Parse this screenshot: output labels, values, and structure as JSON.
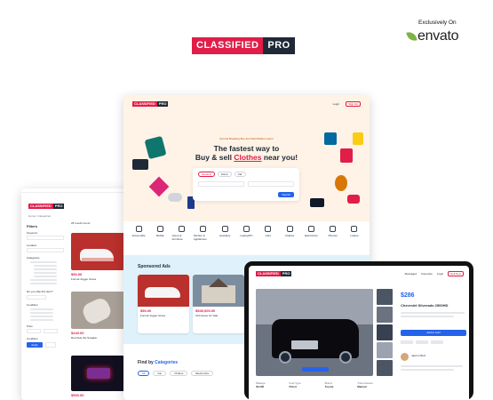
{
  "brand": {
    "name_part1": "CLASSIFIED",
    "name_part2": "PRO",
    "exclusive": "Exclusively On",
    "marketplace": "envato"
  },
  "colors": {
    "accent": "#e11d48",
    "dark": "#1f2937",
    "hero_bg": "#fef3e6",
    "sponsored_bg": "#dff1fb",
    "primary_blue": "#2563eb",
    "envato_green": "#7cb342"
  },
  "center": {
    "tagline": "Ground Breaking Buy And Sell Platform Here!",
    "hero_line1": "The fastest way to",
    "hero_line2_pre": "Buy & sell ",
    "hero_line2_highlight": "Clothes",
    "hero_line2_post": " near you!",
    "search_tabs": [
      "General",
      "Home",
      "Car"
    ],
    "search_button": "Search",
    "nav": [
      "Login",
      "Sign Up"
    ],
    "categories": [
      "Automobile",
      "Mobile",
      "Home & Furniture",
      "Kitchen & Appliances",
      "Jewellery",
      "Laptop/PC",
      "Cars",
      "Clothes",
      "Electronics",
      "Phones",
      "Laptop"
    ],
    "sponsored_title": "Sponsored Ads",
    "ads": [
      {
        "price": "$50.00",
        "title": "Formal Jogger shoes"
      },
      {
        "price": "$545,000.00",
        "title": "Old House for Sale"
      }
    ],
    "find_by_pre": "Find by ",
    "find_by_highlight": "Categories",
    "find_tabs": [
      "All",
      "Car",
      "Clothes",
      "Electronics"
    ]
  },
  "left": {
    "breadcrumb": "Home / Categories",
    "results": "28 results found",
    "filters_title": "Filters",
    "filter_groups": [
      "Keyword",
      "Location",
      "Categories",
      "Do you ship this item?",
      "Condition",
      "Price",
      "Condition"
    ],
    "listings": [
      {
        "price": "$50.00",
        "title": "Formal Jogger shoes"
      },
      {
        "price": "$240.00",
        "title": "Red Sole Zip Sneaker"
      },
      {
        "price": "$500.00",
        "title": ""
      }
    ],
    "apply_button": "Apply"
  },
  "device": {
    "price": "$286",
    "title": "Chevrolet Silverado 2500HD",
    "cta": "Add to Cart",
    "seller": "Jasmin Butz",
    "specs": [
      "Mileage",
      "Fuel Type",
      "Brand",
      "Transmission"
    ],
    "spec_values": [
      "30,000",
      "Petrol",
      "Toyota",
      "Manual"
    ],
    "nav": [
      "Messages",
      "Favourite",
      "Login",
      "Sell Now"
    ]
  }
}
